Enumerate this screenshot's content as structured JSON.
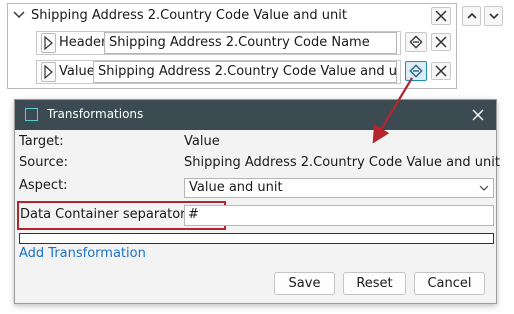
{
  "panel": {
    "title": "Shipping Address 2.Country Code Value and unit",
    "header_row": {
      "label": "Header",
      "value": "Shipping Address 2.Country Code Name"
    },
    "value_row": {
      "label": "Value",
      "value": "Shipping Address 2.Country Code Value and unit"
    }
  },
  "dialog": {
    "title": "Transformations",
    "target_label": "Target:",
    "target_value": "Value",
    "source_label": "Source:",
    "source_value": "Shipping Address 2.Country Code Value and unit",
    "aspect_label": "Aspect:",
    "aspect_value": "Value and unit",
    "separator_label": "Data Container separator:",
    "separator_value": "#",
    "add_transformation": "Add Transformation",
    "save": "Save",
    "reset": "Reset",
    "cancel": "Cancel"
  },
  "colors": {
    "titlebar": "#3c4a52",
    "link": "#1a73c9",
    "highlight": "#b3262e",
    "accent_icon": "#1d8fb0"
  },
  "icons": [
    "chevron-down-icon",
    "close-icon",
    "chevron-up-icon",
    "triangle-right-icon",
    "link-icon",
    "window-icon",
    "arrow-annotation"
  ]
}
